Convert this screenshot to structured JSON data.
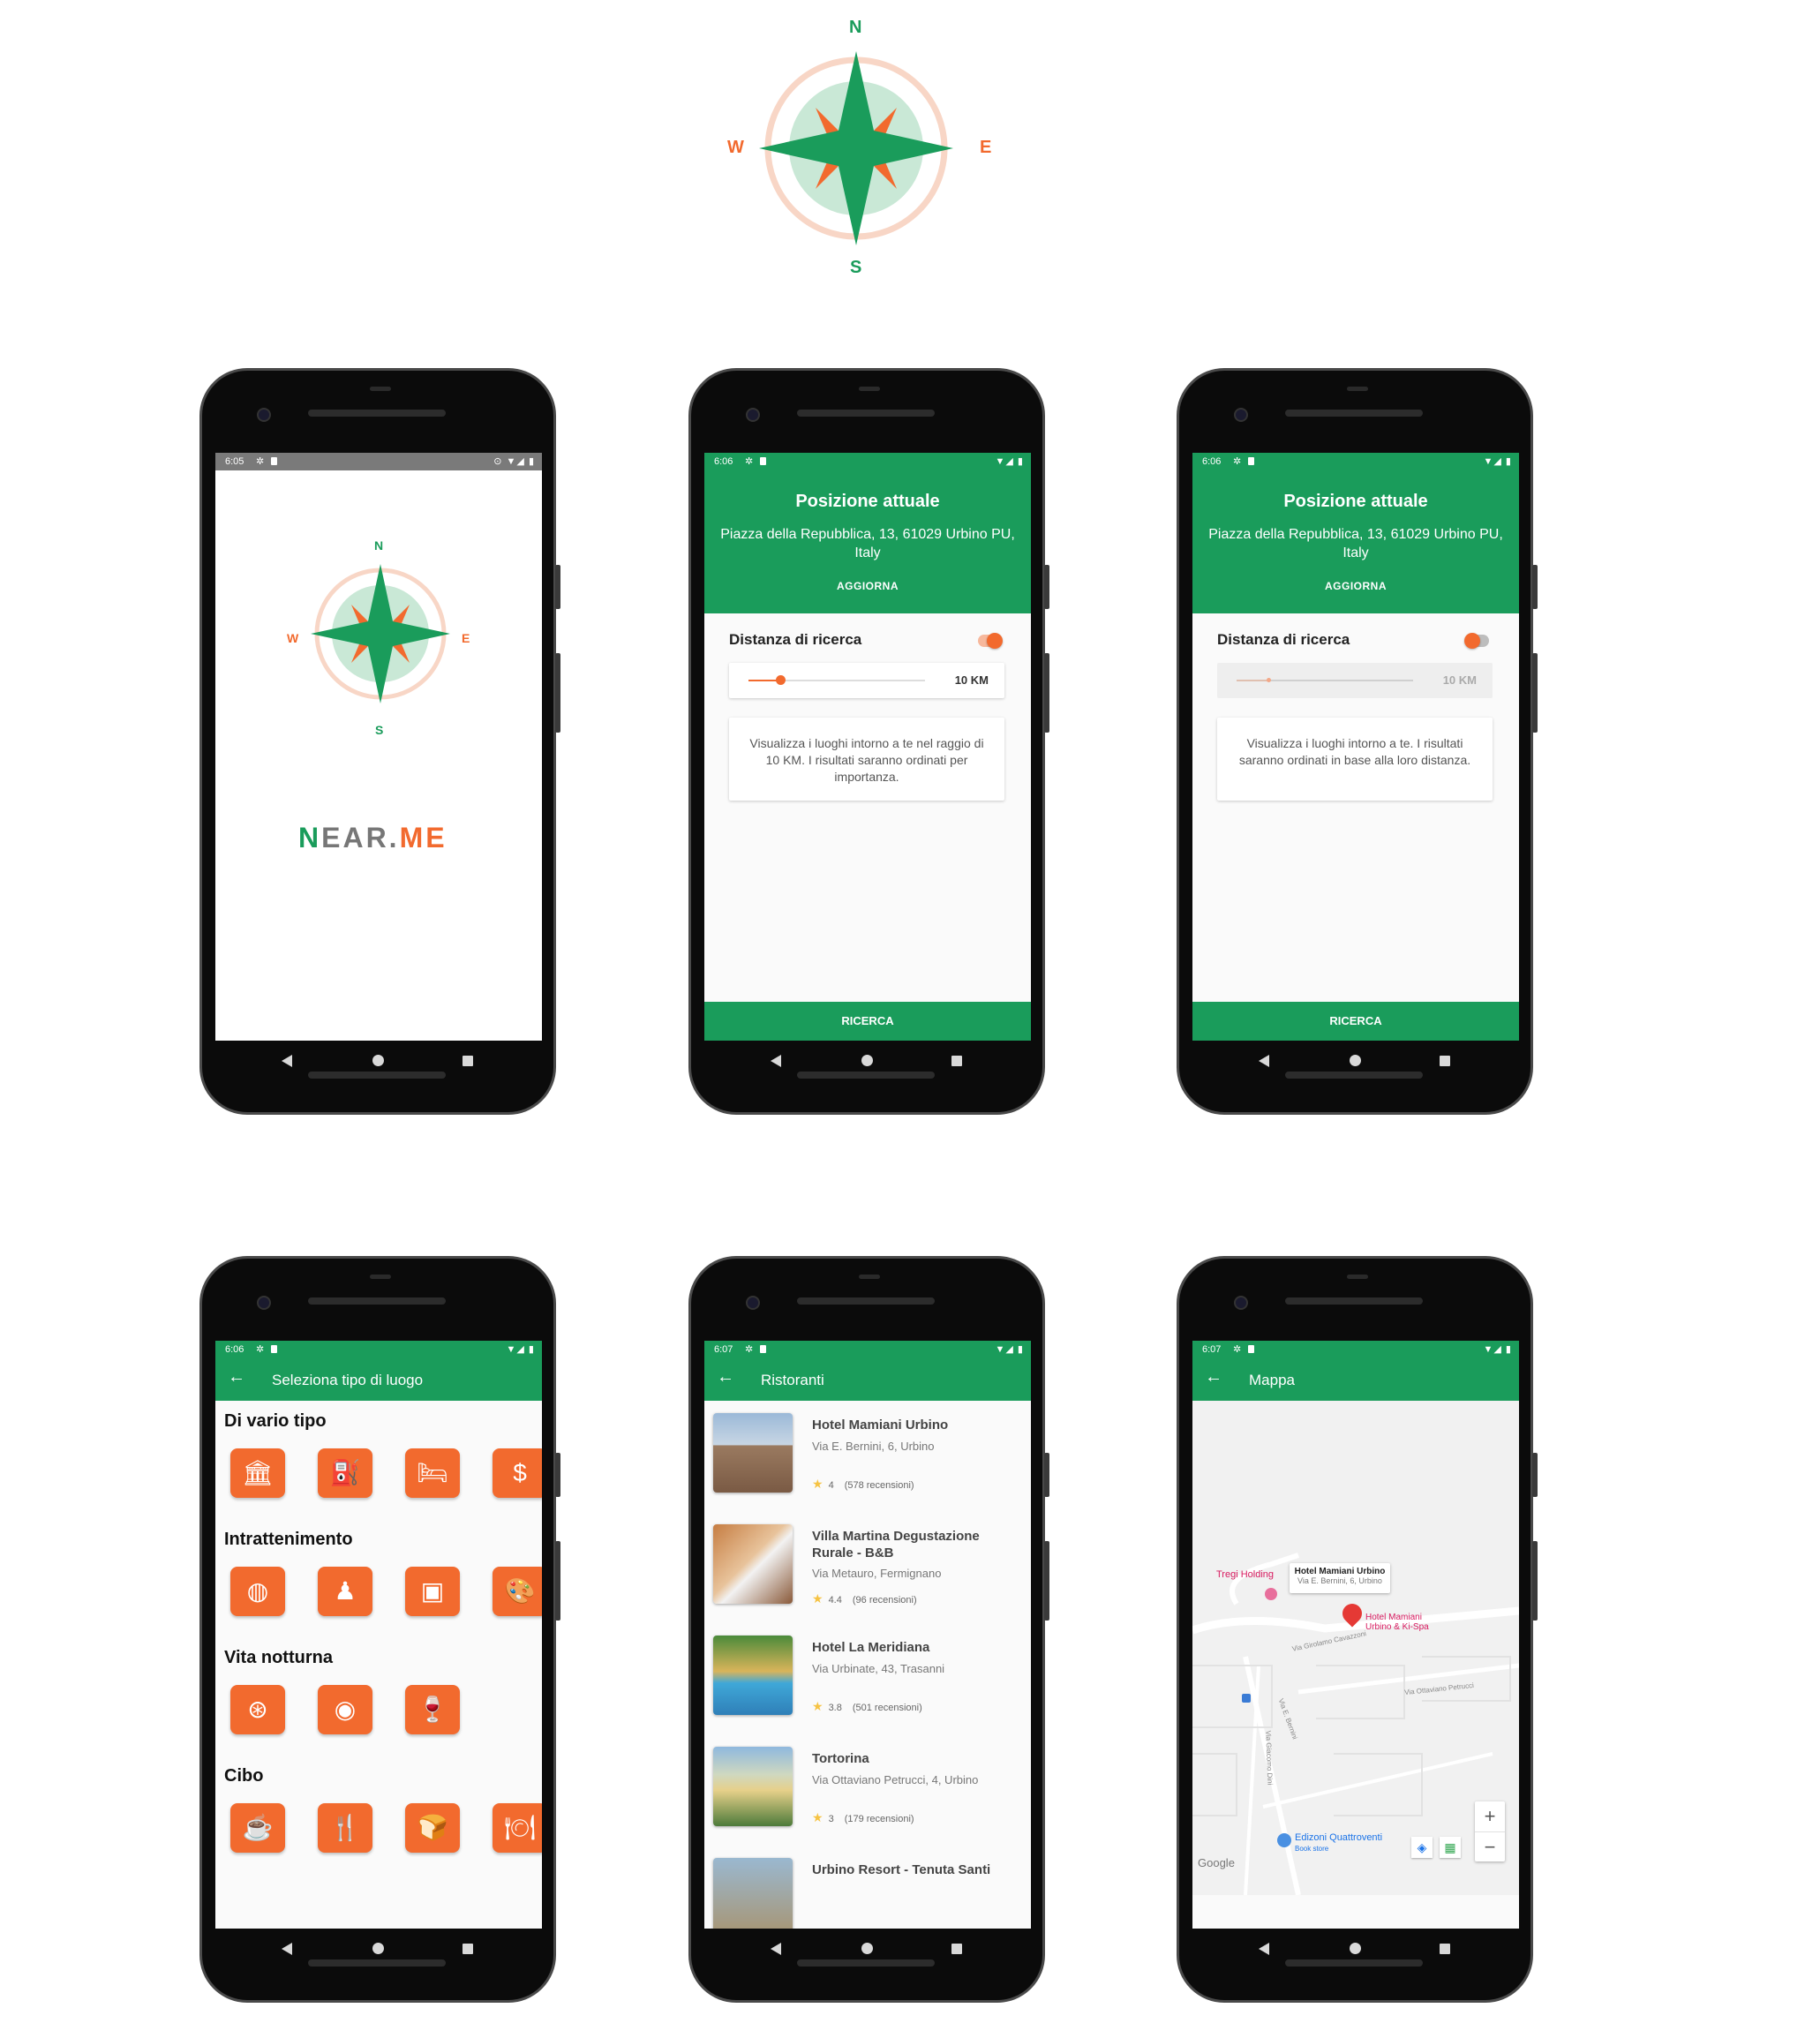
{
  "logo": {
    "n": "N",
    "s": "S",
    "e": "E",
    "w": "W",
    "name_green": "N",
    "name_rest_a": "EAR.",
    "name_rest_b": "ME"
  },
  "colors": {
    "green": "#1a9c5b",
    "orange": "#f26a2e",
    "light_green": "#c9e8d6",
    "peach": "#f8d6c6"
  },
  "splash": {
    "time": "6:05"
  },
  "position_screen_a": {
    "time": "6:06",
    "title": "Posizione attuale",
    "address": "Piazza della Repubblica, 13, 61029 Urbino PU, Italy",
    "update": "AGGIORNA",
    "distance_label": "Distanza di ricerca",
    "toggle_on": true,
    "distance_value": "10 KM",
    "slider_fraction": 0.18,
    "info": "Visualizza i luoghi intorno a te nel raggio di 10 KM. I risultati saranno ordinati per importanza.",
    "search": "RICERCA"
  },
  "position_screen_b": {
    "time": "6:06",
    "title": "Posizione attuale",
    "address": "Piazza della Repubblica, 13, 61029 Urbino PU, Italy",
    "update": "AGGIORNA",
    "distance_label": "Distanza di ricerca",
    "toggle_on": false,
    "distance_value": "10 KM",
    "slider_fraction": 0.18,
    "info": "Visualizza  i luoghi intorno a te. I risultati saranno ordinati in base alla loro distanza.",
    "search": "RICERCA"
  },
  "category_screen": {
    "time": "6:06",
    "title": "Seleziona tipo di luogo",
    "sections": [
      {
        "title": "Di vario tipo",
        "icons": [
          "bank-icon",
          "gas-station-icon",
          "hotel-bed-icon",
          "money-icon"
        ]
      },
      {
        "title": "Intrattenimento",
        "icons": [
          "aquarium-icon",
          "bowling-icon",
          "cinema-icon",
          "art-palette-icon"
        ]
      },
      {
        "title": "Vita notturna",
        "icons": [
          "casino-chip-icon",
          "night-club-disc-icon",
          "bar-wine-icon"
        ]
      },
      {
        "title": "Cibo",
        "icons": [
          "cafe-icon",
          "meal-takeaway-icon",
          "bakery-icon",
          "restaurant-icon"
        ]
      }
    ]
  },
  "list_screen": {
    "time": "6:07",
    "title": "Ristoranti",
    "items": [
      {
        "name": "Hotel Mamiani Urbino",
        "address": "Via E. Bernini, 6, Urbino",
        "rating": "4",
        "reviews": "(578 recensioni)"
      },
      {
        "name": "Villa Martina Degustazione Rurale - B&B",
        "address": "Via Metauro, Fermignano",
        "rating": "4.4",
        "reviews": "(96 recensioni)"
      },
      {
        "name": "Hotel La Meridiana",
        "address": "Via Urbinate, 43, Trasanni",
        "rating": "3.8",
        "reviews": "(501 recensioni)"
      },
      {
        "name": "Tortorina",
        "address": "Via Ottaviano Petrucci, 4, Urbino",
        "rating": "3",
        "reviews": "(179 recensioni)"
      },
      {
        "name": "Urbino Resort - Tenuta Santi",
        "address": "",
        "rating": "",
        "reviews": ""
      }
    ]
  },
  "map_screen": {
    "time": "6:07",
    "title": "Mappa",
    "popup_title": "Hotel Mamiani Urbino",
    "popup_addr": "Via E. Bernini, 6, Urbino",
    "poi_1": "Tregi Holding",
    "poi_2": "Hotel Mamiani Urbino & Ki-Spa",
    "street_1": "Via Girolamo Cavazzoni",
    "street_2": "Via Ottaviano Petrucci",
    "street_3": "Via E. Bernini",
    "street_4": "Via Giacomo Dini",
    "poi_3": "Edizoni Quattroventi",
    "poi_3_sub": "Book store",
    "google": "Google",
    "zoom_in": "+",
    "zoom_out": "−"
  }
}
